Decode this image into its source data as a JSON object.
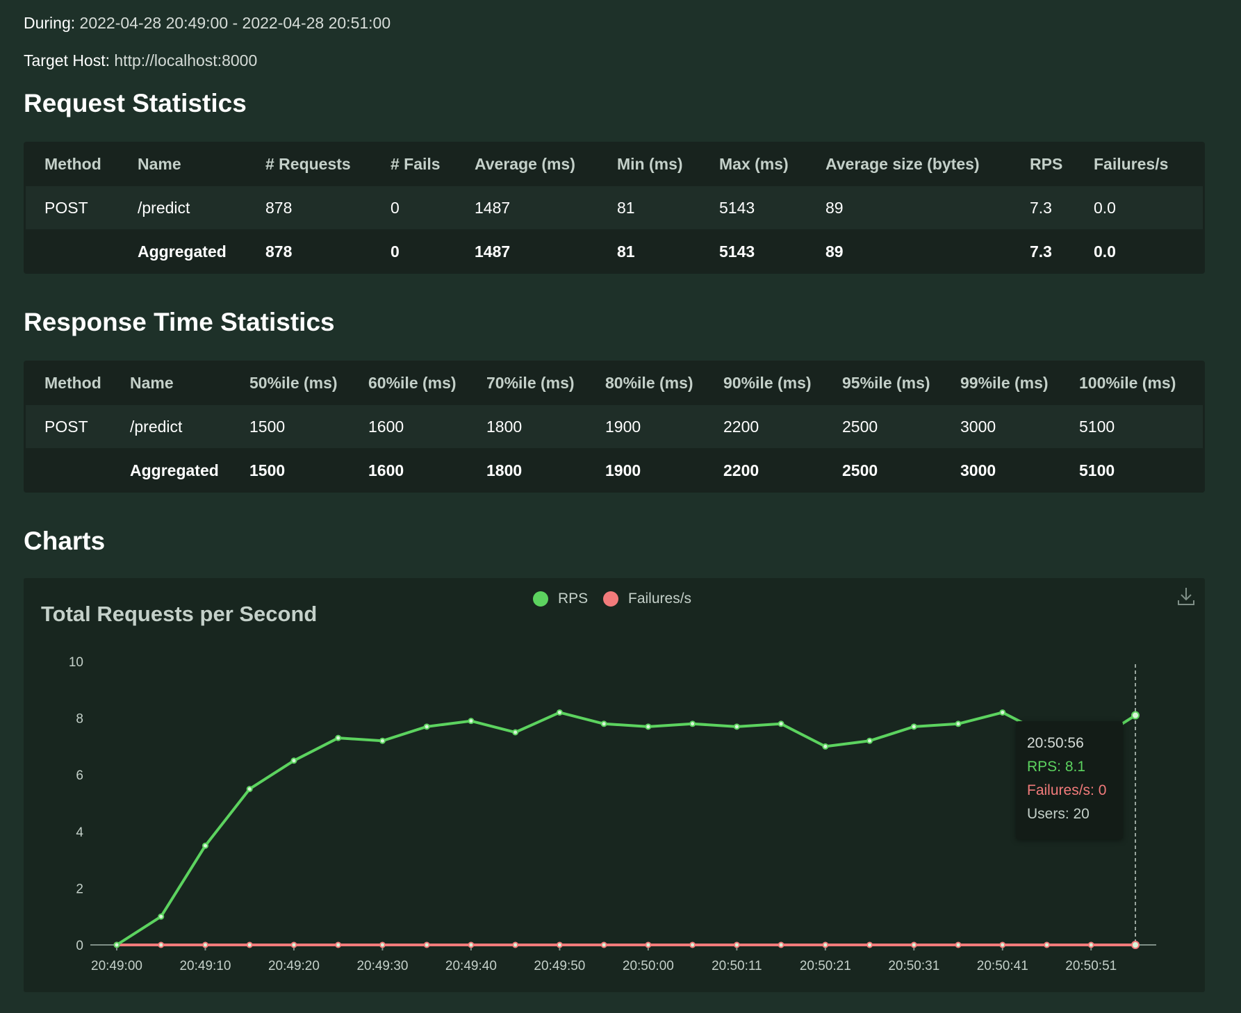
{
  "meta": {
    "during_label": "During:",
    "during_value": "2022-04-28 20:49:00 - 2022-04-28 20:51:00",
    "host_label": "Target Host:",
    "host_value": "http://localhost:8000"
  },
  "request_statistics": {
    "title": "Request Statistics",
    "headers": [
      "Method",
      "Name",
      "# Requests",
      "# Fails",
      "Average (ms)",
      "Min (ms)",
      "Max (ms)",
      "Average size (bytes)",
      "RPS",
      "Failures/s"
    ],
    "rows": [
      [
        "POST",
        "/predict",
        "878",
        "0",
        "1487",
        "81",
        "5143",
        "89",
        "7.3",
        "0.0"
      ],
      [
        "",
        "Aggregated",
        "878",
        "0",
        "1487",
        "81",
        "5143",
        "89",
        "7.3",
        "0.0"
      ]
    ]
  },
  "response_time_statistics": {
    "title": "Response Time Statistics",
    "headers": [
      "Method",
      "Name",
      "50%ile (ms)",
      "60%ile (ms)",
      "70%ile (ms)",
      "80%ile (ms)",
      "90%ile (ms)",
      "95%ile (ms)",
      "99%ile (ms)",
      "100%ile (ms)"
    ],
    "rows": [
      [
        "POST",
        "/predict",
        "1500",
        "1600",
        "1800",
        "1900",
        "2200",
        "2500",
        "3000",
        "5100"
      ],
      [
        "",
        "Aggregated",
        "1500",
        "1600",
        "1800",
        "1900",
        "2200",
        "2500",
        "3000",
        "5100"
      ]
    ]
  },
  "charts": {
    "title": "Charts",
    "download_icon": "download-icon"
  },
  "colors": {
    "rps": "#5cd35f",
    "failures": "#f27b7b",
    "background": "#1e3129",
    "card": "#18261f"
  },
  "tooltip": {
    "time": "20:50:56",
    "rps": "RPS: 8.1",
    "failures": "Failures/s: 0",
    "users": "Users: 20"
  },
  "chart_data": {
    "type": "line",
    "title": "Total Requests per Second",
    "xlabel": "",
    "ylabel": "",
    "ylim": [
      0,
      10
    ],
    "yticks": [
      0,
      2,
      4,
      6,
      8,
      10
    ],
    "x": [
      "20:49:00",
      "20:49:05",
      "20:49:10",
      "20:49:15",
      "20:49:20",
      "20:49:25",
      "20:49:30",
      "20:49:35",
      "20:49:40",
      "20:49:45",
      "20:49:50",
      "20:49:55",
      "20:50:00",
      "20:50:06",
      "20:50:11",
      "20:50:16",
      "20:50:21",
      "20:50:26",
      "20:50:31",
      "20:50:36",
      "20:50:41",
      "20:50:46",
      "20:50:51",
      "20:50:56"
    ],
    "xtick_labels": [
      "20:49:00",
      "20:49:10",
      "20:49:20",
      "20:49:30",
      "20:49:40",
      "20:49:50",
      "20:50:00",
      "20:50:11",
      "20:50:21",
      "20:50:31",
      "20:50:41",
      "20:50:51"
    ],
    "legend": "top-center",
    "series": [
      {
        "name": "RPS",
        "values": [
          0,
          1.0,
          3.5,
          5.5,
          6.5,
          7.3,
          7.2,
          7.7,
          7.9,
          7.5,
          8.2,
          7.8,
          7.7,
          7.8,
          7.7,
          7.8,
          7.0,
          7.2,
          7.7,
          7.8,
          8.2,
          7.4,
          7.1,
          8.1
        ]
      },
      {
        "name": "Failures/s",
        "values": [
          0,
          0,
          0,
          0,
          0,
          0,
          0,
          0,
          0,
          0,
          0,
          0,
          0,
          0,
          0,
          0,
          0,
          0,
          0,
          0,
          0,
          0,
          0,
          0
        ]
      }
    ]
  }
}
